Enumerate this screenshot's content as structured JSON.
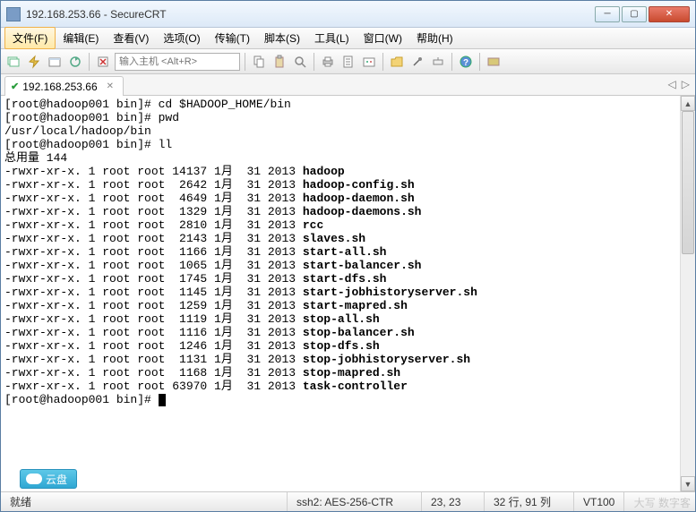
{
  "title": "192.168.253.66 - SecureCRT",
  "menu": [
    "文件(F)",
    "编辑(E)",
    "查看(V)",
    "选项(O)",
    "传输(T)",
    "脚本(S)",
    "工具(L)",
    "窗口(W)",
    "帮助(H)"
  ],
  "host_placeholder": "输入主机 <Alt+R>",
  "tab": {
    "label": "192.168.253.66",
    "connected": true
  },
  "tab_nav": {
    "left": "◁",
    "right": "▷"
  },
  "terminal": {
    "prompt": "[root@hadoop001 bin]#",
    "cmds": {
      "cd": "cd $HADOOP_HOME/bin",
      "pwd_cmd": "pwd",
      "pwd_out": "/usr/local/hadoop/bin",
      "ll": "ll",
      "total": "总用量 144"
    },
    "files": [
      {
        "perm": "-rwxr-xr-x.",
        "links": "1",
        "own": "root",
        "grp": "root",
        "size": "14137",
        "mon": "1月",
        "day": "31",
        "year": "2013",
        "name": "hadoop"
      },
      {
        "perm": "-rwxr-xr-x.",
        "links": "1",
        "own": "root",
        "grp": "root",
        "size": "2642",
        "mon": "1月",
        "day": "31",
        "year": "2013",
        "name": "hadoop-config.sh"
      },
      {
        "perm": "-rwxr-xr-x.",
        "links": "1",
        "own": "root",
        "grp": "root",
        "size": "4649",
        "mon": "1月",
        "day": "31",
        "year": "2013",
        "name": "hadoop-daemon.sh"
      },
      {
        "perm": "-rwxr-xr-x.",
        "links": "1",
        "own": "root",
        "grp": "root",
        "size": "1329",
        "mon": "1月",
        "day": "31",
        "year": "2013",
        "name": "hadoop-daemons.sh"
      },
      {
        "perm": "-rwxr-xr-x.",
        "links": "1",
        "own": "root",
        "grp": "root",
        "size": "2810",
        "mon": "1月",
        "day": "31",
        "year": "2013",
        "name": "rcc"
      },
      {
        "perm": "-rwxr-xr-x.",
        "links": "1",
        "own": "root",
        "grp": "root",
        "size": "2143",
        "mon": "1月",
        "day": "31",
        "year": "2013",
        "name": "slaves.sh"
      },
      {
        "perm": "-rwxr-xr-x.",
        "links": "1",
        "own": "root",
        "grp": "root",
        "size": "1166",
        "mon": "1月",
        "day": "31",
        "year": "2013",
        "name": "start-all.sh"
      },
      {
        "perm": "-rwxr-xr-x.",
        "links": "1",
        "own": "root",
        "grp": "root",
        "size": "1065",
        "mon": "1月",
        "day": "31",
        "year": "2013",
        "name": "start-balancer.sh"
      },
      {
        "perm": "-rwxr-xr-x.",
        "links": "1",
        "own": "root",
        "grp": "root",
        "size": "1745",
        "mon": "1月",
        "day": "31",
        "year": "2013",
        "name": "start-dfs.sh"
      },
      {
        "perm": "-rwxr-xr-x.",
        "links": "1",
        "own": "root",
        "grp": "root",
        "size": "1145",
        "mon": "1月",
        "day": "31",
        "year": "2013",
        "name": "start-jobhistoryserver.sh"
      },
      {
        "perm": "-rwxr-xr-x.",
        "links": "1",
        "own": "root",
        "grp": "root",
        "size": "1259",
        "mon": "1月",
        "day": "31",
        "year": "2013",
        "name": "start-mapred.sh"
      },
      {
        "perm": "-rwxr-xr-x.",
        "links": "1",
        "own": "root",
        "grp": "root",
        "size": "1119",
        "mon": "1月",
        "day": "31",
        "year": "2013",
        "name": "stop-all.sh"
      },
      {
        "perm": "-rwxr-xr-x.",
        "links": "1",
        "own": "root",
        "grp": "root",
        "size": "1116",
        "mon": "1月",
        "day": "31",
        "year": "2013",
        "name": "stop-balancer.sh"
      },
      {
        "perm": "-rwxr-xr-x.",
        "links": "1",
        "own": "root",
        "grp": "root",
        "size": "1246",
        "mon": "1月",
        "day": "31",
        "year": "2013",
        "name": "stop-dfs.sh"
      },
      {
        "perm": "-rwxr-xr-x.",
        "links": "1",
        "own": "root",
        "grp": "root",
        "size": "1131",
        "mon": "1月",
        "day": "31",
        "year": "2013",
        "name": "stop-jobhistoryserver.sh"
      },
      {
        "perm": "-rwxr-xr-x.",
        "links": "1",
        "own": "root",
        "grp": "root",
        "size": "1168",
        "mon": "1月",
        "day": "31",
        "year": "2013",
        "name": "stop-mapred.sh"
      },
      {
        "perm": "-rwxr-xr-x.",
        "links": "1",
        "own": "root",
        "grp": "root",
        "size": "63970",
        "mon": "1月",
        "day": "31",
        "year": "2013",
        "name": "task-controller"
      }
    ]
  },
  "cloud_label": "云盘",
  "status": {
    "ready": "就绪",
    "ssh": "ssh2: AES-256-CTR",
    "pos": "23,  23",
    "dim": "32 行, 91 列",
    "term": "VT100"
  },
  "watermark": "大写 数字客"
}
